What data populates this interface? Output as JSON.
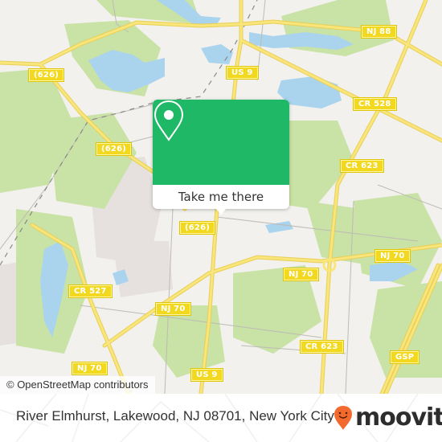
{
  "map": {
    "road_labels": [
      {
        "id": "626-west",
        "text": "(626)"
      },
      {
        "id": "626-center",
        "text": "(626)"
      },
      {
        "id": "626-south",
        "text": "(626)"
      },
      {
        "id": "us9-north",
        "text": "US 9"
      },
      {
        "id": "nj88",
        "text": "NJ 88"
      },
      {
        "id": "cr528",
        "text": "CR 528"
      },
      {
        "id": "cr623-north",
        "text": "CR 623"
      },
      {
        "id": "nj70-east",
        "text": "NJ 70"
      },
      {
        "id": "nj70-center",
        "text": "NJ 70"
      },
      {
        "id": "cr527",
        "text": "CR 527"
      },
      {
        "id": "nj70-west",
        "text": "NJ 70"
      },
      {
        "id": "nj70-southwest",
        "text": "NJ 70"
      },
      {
        "id": "cr623-south",
        "text": "CR 623"
      },
      {
        "id": "gsp",
        "text": "GSP"
      },
      {
        "id": "us9-south",
        "text": "US 9"
      }
    ],
    "colors": {
      "land": "#f2f1ed",
      "forest": "#c9e2a5",
      "water": "#aad3ee",
      "road_major": "#f8e57c",
      "road_minor": "#bdbbb6",
      "residential": "#e6e1df",
      "shield": "#f2d81f"
    }
  },
  "popup": {
    "icon": "location-pin-icon",
    "button_label": "Take me there",
    "accent": "#1fb866"
  },
  "attribution": "© OpenStreetMap contributors",
  "footer": {
    "address": "River Elmhurst, Lakewood, NJ 08701, New York City",
    "brand": "moovit",
    "brand_color": "#f26a2e"
  }
}
